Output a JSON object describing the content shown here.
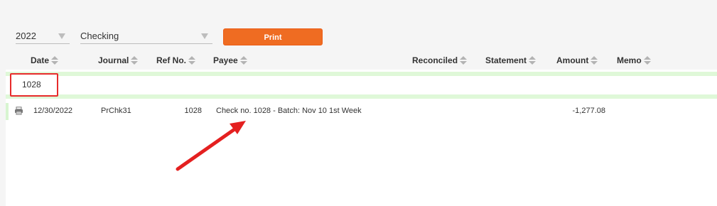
{
  "filters": {
    "year": "2022",
    "account": "Checking",
    "print_label": "Print"
  },
  "columns": [
    {
      "label": "Date"
    },
    {
      "label": "Journal"
    },
    {
      "label": "Ref No."
    },
    {
      "label": "Payee"
    },
    {
      "label": "Reconciled"
    },
    {
      "label": "Statement"
    },
    {
      "label": "Amount"
    },
    {
      "label": "Memo"
    }
  ],
  "search": {
    "ref_no_value": "1028"
  },
  "rows": [
    {
      "date": "12/30/2022",
      "journal": "PrChk31",
      "ref_no": "1028",
      "payee": "Check no. 1028 - Batch: Nov 10 1st Week",
      "reconciled": "",
      "statement": "",
      "amount": "-1,277.08",
      "memo": ""
    }
  ],
  "colors": {
    "accent": "#ef6c22",
    "highlight_border": "#e72b2b",
    "row_highlight": "#dff8d8",
    "arrow": "#e42020"
  },
  "icons": {
    "printer": "printer-icon",
    "sort": "sort-icon",
    "annotation_arrow": "arrow-icon"
  }
}
